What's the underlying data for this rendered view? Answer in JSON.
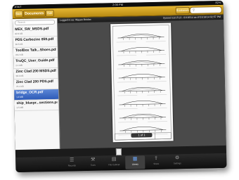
{
  "status_bar": {
    "carrier": "AT&T",
    "time": "2:00 PM",
    "battery": "82%"
  },
  "nav": {
    "back_label": "Back",
    "title": "Documents",
    "edit_label": "Edit",
    "bookmark_label": "Bookmark",
    "search_icon": "search-icon"
  },
  "sidebar": {
    "search_placeholder": "Search",
    "files": [
      {
        "name": "MEX_SW_MSDS.pdf",
        "size": "82.6 KB",
        "selected": false
      },
      {
        "name": "PDS Carbozinc 859.pdf",
        "size": "66.5 KB",
        "selected": false
      },
      {
        "name": "ToolBox Talk...Shoes.pdf",
        "size": "36.2 KB",
        "selected": false
      },
      {
        "name": "TruQC_User_Guide.pdf",
        "size": "2.1 MB",
        "selected": false
      },
      {
        "name": "Zinc Clad 200 MSDS.pdf",
        "size": "58.3 KB",
        "selected": false
      },
      {
        "name": "Zinc Clad 200 PDS.pdf",
        "size": "72.4 KB",
        "selected": false
      },
      {
        "name": "bridge_OCR.pdf",
        "size": "1.4 MB",
        "selected": true
      },
      {
        "name": "ship_bluepr...sections.pdf",
        "size": "2.5 MB",
        "selected": false
      }
    ]
  },
  "info_bar": {
    "left": "Logged in as: Wayan Brinker",
    "right": "Synced 12/17/13 - 01/16/14 as of 01/16/14 02:57 PM"
  },
  "document": {
    "page_indicator": "1 of 1"
  },
  "tabs": [
    {
      "id": "docs",
      "label": "Records",
      "icon": "list-icon",
      "glyph": "☰",
      "active": false
    },
    {
      "id": "tools",
      "label": "Tools",
      "icon": "tools-icon",
      "glyph": "⚒",
      "active": false
    },
    {
      "id": "cases",
      "label": "File Cabinet",
      "icon": "cabinet-icon",
      "glyph": "▤",
      "active": false
    },
    {
      "id": "library",
      "label": "Library",
      "icon": "library-icon",
      "glyph": "▦",
      "active": true
    },
    {
      "id": "share",
      "label": "Share",
      "icon": "share-icon",
      "glyph": "⇪",
      "active": false
    },
    {
      "id": "settings",
      "label": "Settings",
      "icon": "gear-icon",
      "glyph": "⚙",
      "active": false
    }
  ],
  "colors": {
    "nav_gold": "#d4a62a",
    "selection_blue": "#3a67c4",
    "tab_active": "#6aa1ef"
  }
}
